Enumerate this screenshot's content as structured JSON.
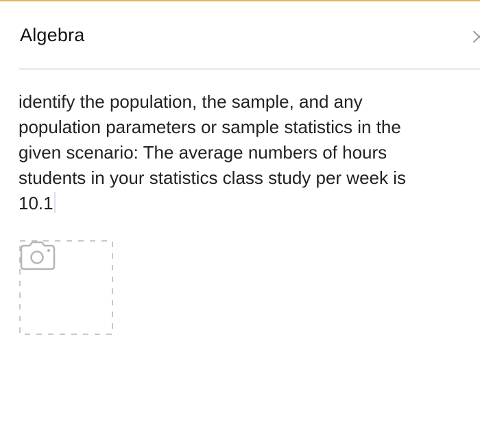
{
  "header": {
    "title": "Algebra",
    "close_icon": "close-icon"
  },
  "question": {
    "text": "identify the population, the sample, and any\npopulation parameters or sample statistics in the\ngiven scenario: The average numbers of hours\nstudents in your statistics class study per week is\n10.1"
  },
  "attachment": {
    "icon": "camera-icon"
  },
  "colors": {
    "accent_top": "#d4b779",
    "divider": "#ececec",
    "dashed_border": "#c8c8c8",
    "icon_gray": "#b5b5b5"
  }
}
